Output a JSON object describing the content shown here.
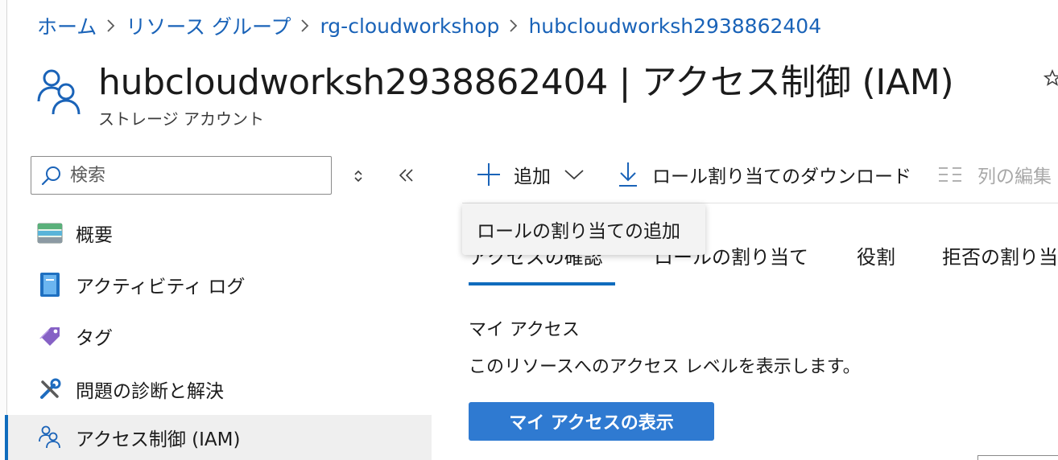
{
  "breadcrumb": [
    {
      "label": "ホーム"
    },
    {
      "label": "リソース グループ"
    },
    {
      "label": "rg-cloudworkshop"
    },
    {
      "label": "hubcloudworksh2938862404"
    }
  ],
  "header": {
    "title": "hubcloudworksh2938862404 | アクセス制御 (IAM)",
    "subtitle": "ストレージ アカウント"
  },
  "sidebar": {
    "search_placeholder": "検索",
    "items": [
      {
        "label": "概要",
        "icon": "overview-icon"
      },
      {
        "label": "アクティビティ ログ",
        "icon": "activity-log-icon"
      },
      {
        "label": "タグ",
        "icon": "tag-icon"
      },
      {
        "label": "問題の診断と解決",
        "icon": "wrench-icon"
      },
      {
        "label": "アクセス制御 (IAM)",
        "icon": "people-icon",
        "active": true
      }
    ]
  },
  "toolbar": {
    "add_label": "追加",
    "download_label": "ロール割り当てのダウンロード",
    "edit_columns_label": "列の編集"
  },
  "tooltip": {
    "text": "ロールの割り当ての追加"
  },
  "tabs": [
    {
      "label": "アクセスの確認",
      "active": true
    },
    {
      "label": "ロールの割り当て"
    },
    {
      "label": "役割"
    },
    {
      "label": "拒否の割り当て"
    }
  ],
  "main": {
    "section_title": "マイ アクセス",
    "section_description": "このリソースへのアクセス レベルを表示します。",
    "view_button_label": "マイ アクセスの表示"
  },
  "colors": {
    "link": "#1a63b8",
    "accent": "#0f6cbd",
    "primary_button": "#2f7ad1"
  }
}
